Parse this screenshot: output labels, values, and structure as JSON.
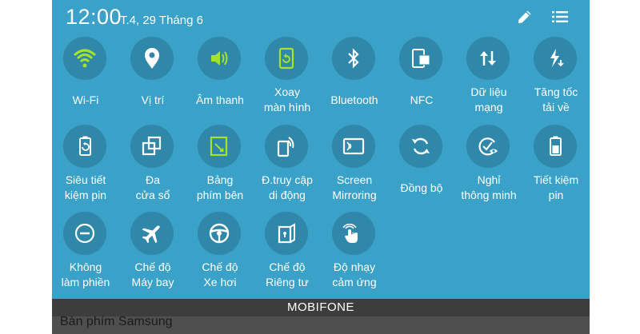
{
  "status": {
    "time": "12:00",
    "date": "T.4, 29 Tháng 6"
  },
  "header_icons": {
    "edit": "pencil-icon",
    "list": "list-icon"
  },
  "colors": {
    "panel": "#3aa1c8",
    "circle": "#2f88a9",
    "active": "#a7e22a",
    "icon": "#ffffff"
  },
  "tiles": [
    {
      "line1": "Wi-Fi",
      "line2": "",
      "icon": "wifi-icon",
      "active": true
    },
    {
      "line1": "Vị trí",
      "line2": "",
      "icon": "location-pin-icon",
      "active": false
    },
    {
      "line1": "Âm thanh",
      "line2": "",
      "icon": "speaker-icon",
      "active": true
    },
    {
      "line1": "Xoay",
      "line2": "màn hình",
      "icon": "rotate-screen-icon",
      "active": true
    },
    {
      "line1": "Bluetooth",
      "line2": "",
      "icon": "bluetooth-icon",
      "active": false
    },
    {
      "line1": "NFC",
      "line2": "",
      "icon": "nfc-icon",
      "active": false
    },
    {
      "line1": "Dữ liệu",
      "line2": "mạng",
      "icon": "mobile-data-icon",
      "active": false
    },
    {
      "line1": "Tăng tốc",
      "line2": "tải về",
      "icon": "download-booster-icon",
      "active": false
    },
    {
      "line1": "Siêu tiết",
      "line2": "kiệm pin",
      "icon": "ultra-power-saving-icon",
      "active": false
    },
    {
      "line1": "Đa",
      "line2": "cửa sổ",
      "icon": "multi-window-icon",
      "active": false
    },
    {
      "line1": "Bảng",
      "line2": "phím bên",
      "icon": "toolbox-icon",
      "active": true
    },
    {
      "line1": "Đ.truy cập",
      "line2": "di động",
      "icon": "mobile-hotspot-icon",
      "active": false
    },
    {
      "line1": "Screen",
      "line2": "Mirroring",
      "icon": "screen-mirroring-icon",
      "active": false
    },
    {
      "line1": "Đồng bộ",
      "line2": "",
      "icon": "sync-icon",
      "active": false
    },
    {
      "line1": "Nghỉ",
      "line2": "thông minh",
      "icon": "smart-stay-icon",
      "active": false
    },
    {
      "line1": "Tiết kiệm",
      "line2": "pin",
      "icon": "power-saving-icon",
      "active": false
    },
    {
      "line1": "Không",
      "line2": "làm phiền",
      "icon": "do-not-disturb-icon",
      "active": false
    },
    {
      "line1": "Chế độ",
      "line2": "Máy bay",
      "icon": "airplane-icon",
      "active": false
    },
    {
      "line1": "Chế độ",
      "line2": "Xe hơi",
      "icon": "steering-wheel-icon",
      "active": false
    },
    {
      "line1": "Chế độ",
      "line2": "Riêng tư",
      "icon": "private-mode-icon",
      "active": false
    },
    {
      "line1": "Độ nhạy",
      "line2": "cảm ứng",
      "icon": "touch-sensitivity-icon",
      "active": false
    }
  ],
  "carrier": "MOBIFONE",
  "keyboard_hint": "Bàn phím Samsung"
}
